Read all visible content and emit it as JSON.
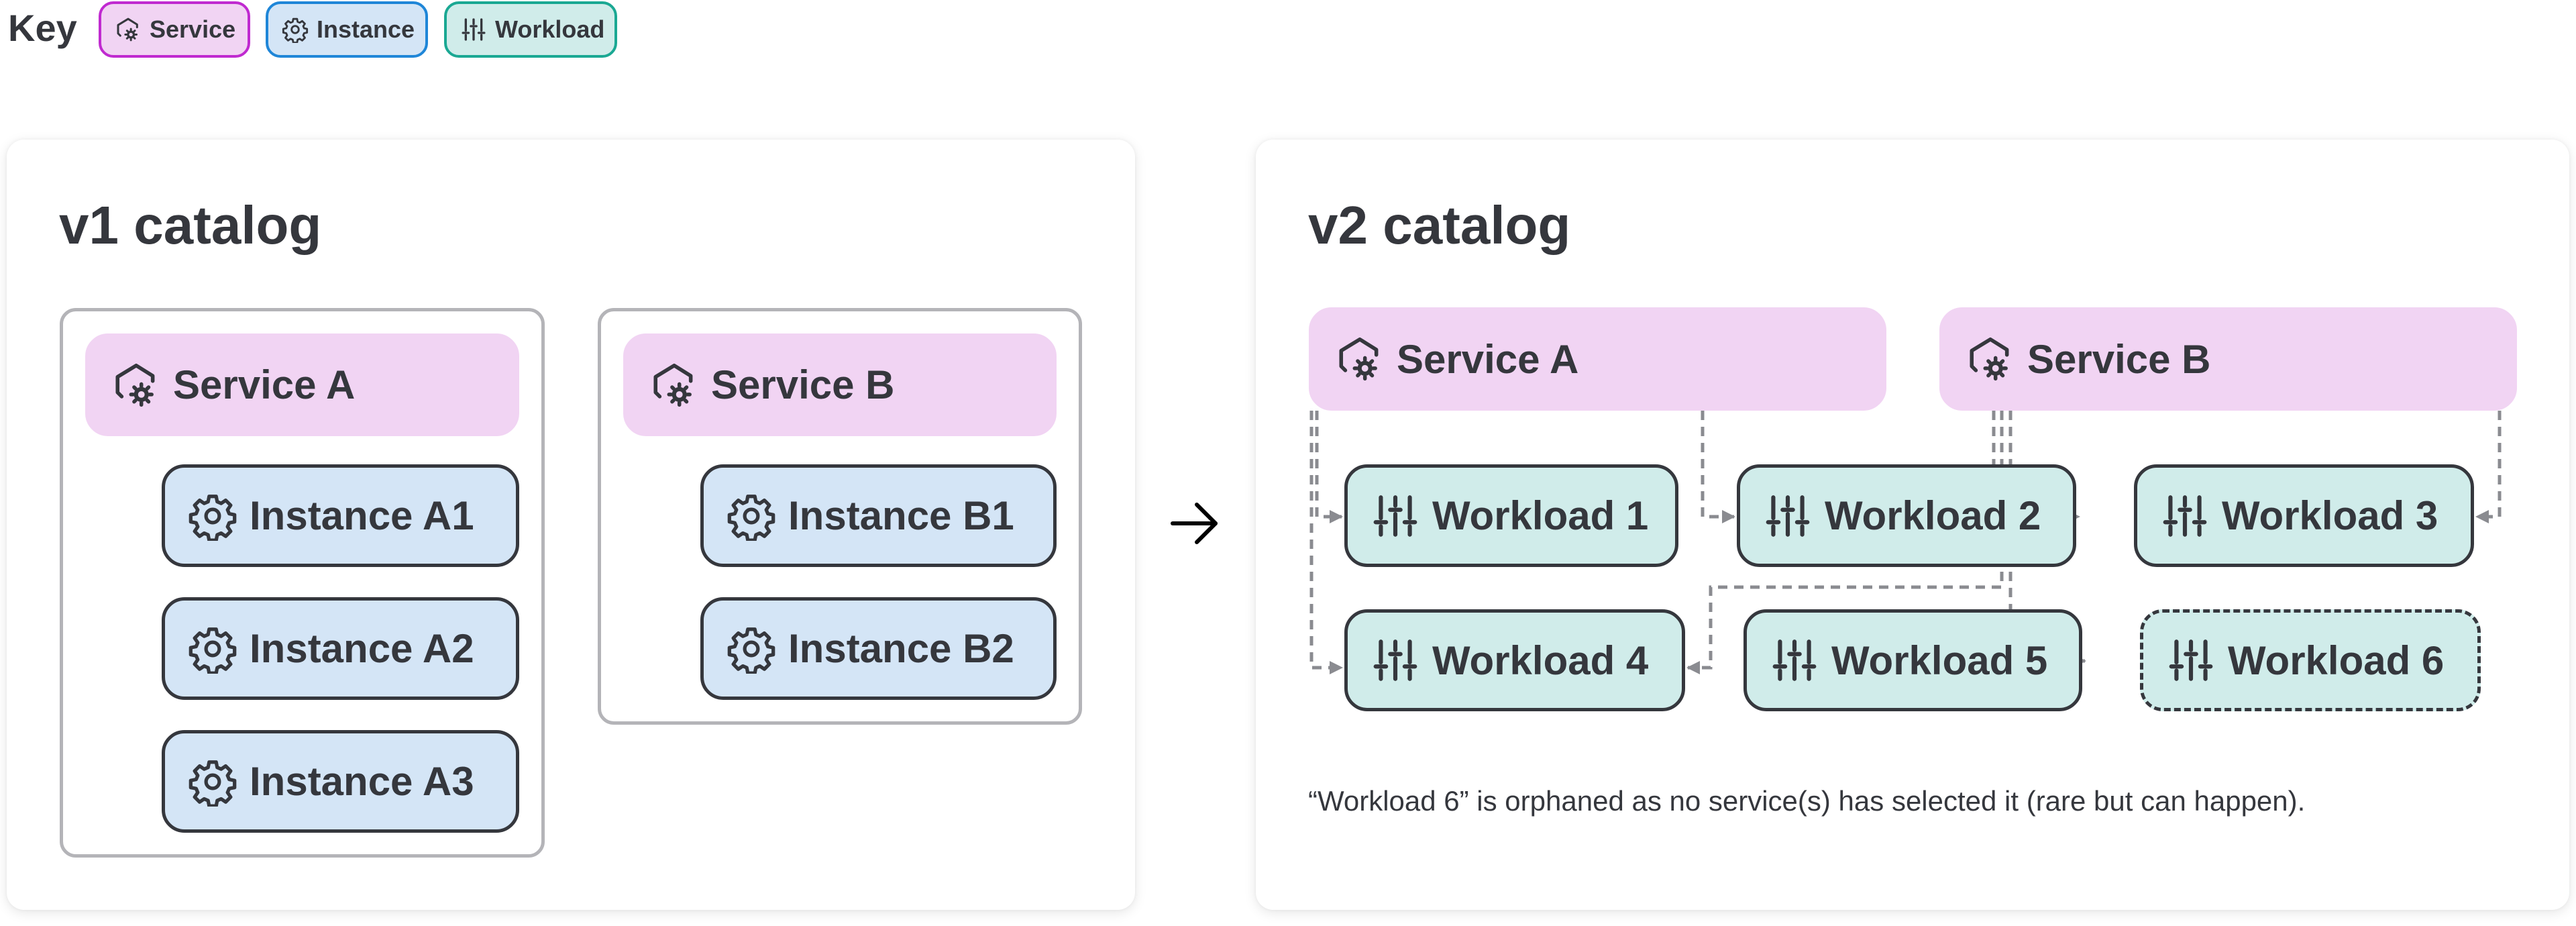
{
  "key": {
    "title": "Key",
    "items": [
      {
        "label": "Service",
        "icon": "service-icon",
        "kind": "service"
      },
      {
        "label": "Instance",
        "icon": "gear-icon",
        "kind": "instance"
      },
      {
        "label": "Workload",
        "icon": "sliders-icon",
        "kind": "workload"
      }
    ]
  },
  "colors": {
    "service_fill": "#f1d4f3",
    "service_border": "#c02ad0",
    "instance_fill": "#d4e5f6",
    "instance_border": "#1f86d8",
    "workload_fill": "#d0ecea",
    "workload_border": "#1aa893",
    "connector": "#8a8b90",
    "text": "#35373d"
  },
  "v1": {
    "title": "v1 catalog",
    "groups": [
      {
        "service": "Service A",
        "instances": [
          "Instance A1",
          "Instance A2",
          "Instance A3"
        ]
      },
      {
        "service": "Service B",
        "instances": [
          "Instance B1",
          "Instance B2"
        ]
      }
    ]
  },
  "transition_arrow": "→",
  "v2": {
    "title": "v2 catalog",
    "services": [
      "Service A",
      "Service B"
    ],
    "workloads": [
      "Workload 1",
      "Workload 2",
      "Workload 3",
      "Workload 4",
      "Workload 5",
      "Workload 6"
    ],
    "selections": [
      {
        "from": "Service A",
        "to": "Workload 1"
      },
      {
        "from": "Service A",
        "to": "Workload 4"
      },
      {
        "from": "Service A",
        "to": "Workload 2"
      },
      {
        "from": "Service B",
        "to": "Workload 2"
      },
      {
        "from": "Service B",
        "to": "Workload 4"
      },
      {
        "from": "Service B",
        "to": "Workload 5"
      },
      {
        "from": "Service B",
        "to": "Workload 3"
      }
    ],
    "orphaned": [
      "Workload 6"
    ],
    "caption": "“Workload 6” is orphaned as no service(s) has selected it (rare but can happen)."
  }
}
